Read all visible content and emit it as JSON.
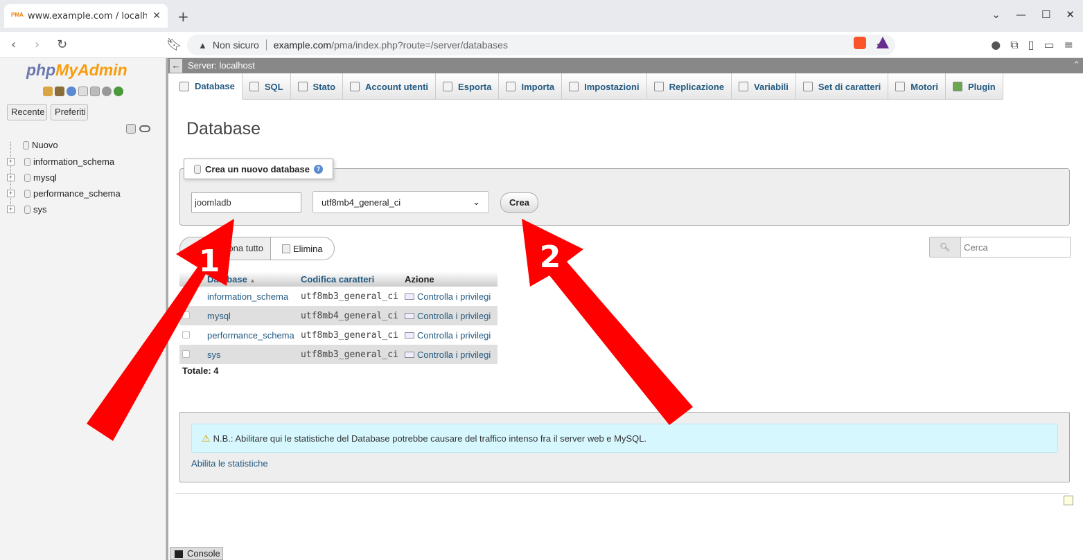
{
  "browser": {
    "tab_title": "www.example.com / localhost",
    "tab_favicon_text": "PMA",
    "new_tab_symbol": "+",
    "security_label": "Non sicuro",
    "url_host": "example.com",
    "url_path": "/pma/index.php?route=/server/databases"
  },
  "sidebar": {
    "logo_php": "php",
    "logo_myadmin": "MyAdmin",
    "recent_label": "Recente",
    "favorites_label": "Preferiti",
    "tree": [
      {
        "label": "Nuovo",
        "expandable": false
      },
      {
        "label": "information_schema",
        "expandable": true
      },
      {
        "label": "mysql",
        "expandable": true
      },
      {
        "label": "performance_schema",
        "expandable": true
      },
      {
        "label": "sys",
        "expandable": true
      }
    ]
  },
  "server_bar": {
    "title": "Server: localhost"
  },
  "tabs": [
    {
      "label": "Database",
      "active": true
    },
    {
      "label": "SQL"
    },
    {
      "label": "Stato"
    },
    {
      "label": "Account utenti"
    },
    {
      "label": "Esporta"
    },
    {
      "label": "Importa"
    },
    {
      "label": "Impostazioni"
    },
    {
      "label": "Replicazione"
    },
    {
      "label": "Variabili"
    },
    {
      "label": "Set di caratteri"
    },
    {
      "label": "Motori"
    },
    {
      "label": "Plugin"
    }
  ],
  "page": {
    "title": "Database",
    "create_legend": "Crea un nuovo database",
    "db_name_value": "joomladb",
    "collation_value": "utf8mb4_general_ci",
    "create_button": "Crea",
    "select_all_label": "Seleziona tutto",
    "drop_label": "Elimina",
    "search_placeholder": "Cerca"
  },
  "table": {
    "headers": {
      "database": "Database",
      "collation": "Codifica caratteri",
      "action": "Azione"
    },
    "rows": [
      {
        "name": "information_schema",
        "collation": "utf8mb3_general_ci",
        "action": "Controlla i privilegi"
      },
      {
        "name": "mysql",
        "collation": "utf8mb4_general_ci",
        "action": "Controlla i privilegi"
      },
      {
        "name": "performance_schema",
        "collation": "utf8mb3_general_ci",
        "action": "Controlla i privilegi"
      },
      {
        "name": "sys",
        "collation": "utf8mb3_general_ci",
        "action": "Controlla i privilegi"
      }
    ],
    "total": "Totale: 4"
  },
  "stats": {
    "notice": "N.B.: Abilitare qui le statistiche del Database potrebbe causare del traffico intenso fra il server web e MySQL.",
    "enable_link": "Abilita le statistiche"
  },
  "console_label": "Console",
  "annotations": {
    "arrow1": "1",
    "arrow2": "2",
    "color": "#ff0000"
  }
}
